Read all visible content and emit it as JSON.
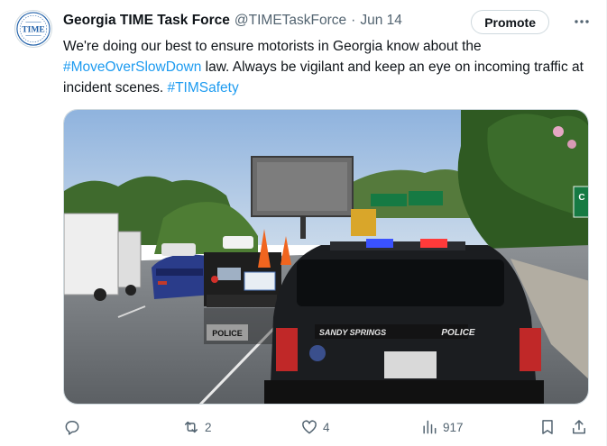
{
  "tweet": {
    "avatar_text": "TIME",
    "display_name": "Georgia TIME Task Force",
    "handle": "@TIMETaskForce",
    "separator": "·",
    "date": "Jun 14",
    "promote_label": "Promote",
    "text_part1": "We're doing our best to ensure motorists in Georgia know about the ",
    "hashtag1": "#MoveOverSlowDown",
    "text_part2": " law. Always be vigilant and keep an eye on incoming traffic at incident scenes. ",
    "hashtag2": "#TIMSafety",
    "media": {
      "car_brand_left": "SANDY SPRINGS",
      "car_label_right": "POLICE",
      "truck_label": "POLICE",
      "sign_text": "C"
    },
    "actions": {
      "reply_count": "",
      "retweet_count": "2",
      "like_count": "4",
      "views_count": "917"
    }
  },
  "colors": {
    "link": "#1d9bf0",
    "secondary_text": "#536471",
    "primary_text": "#0f1419"
  },
  "icons": [
    "avatar-logo",
    "more-icon",
    "reply-icon",
    "retweet-icon",
    "like-icon",
    "views-icon",
    "bookmark-icon",
    "share-icon"
  ]
}
